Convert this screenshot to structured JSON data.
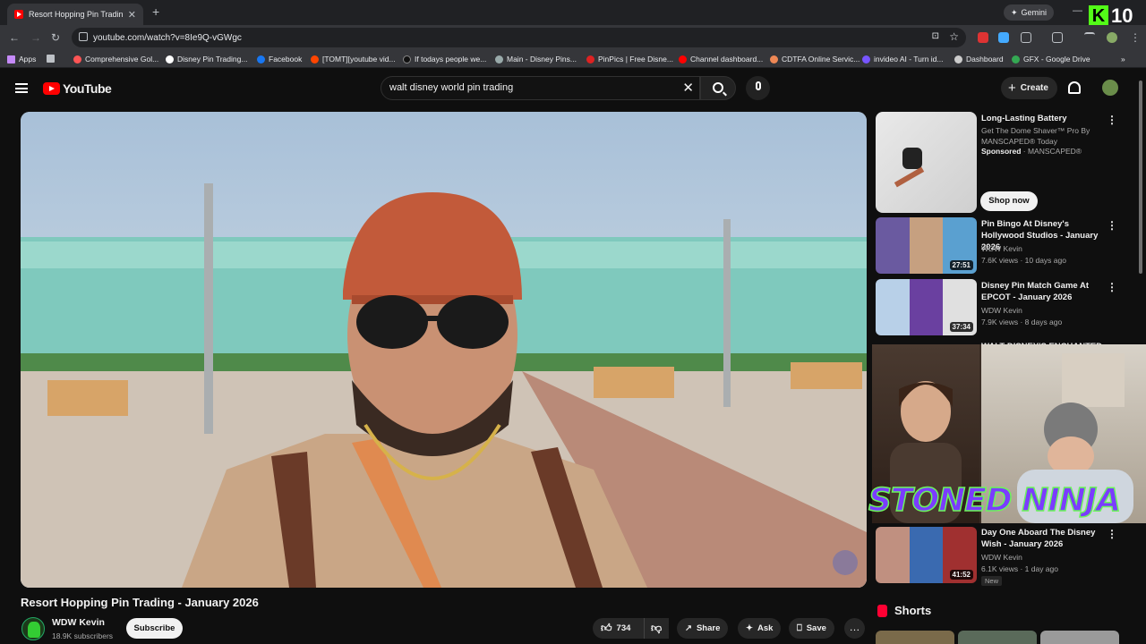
{
  "browser": {
    "tab_title": "Resort Hopping Pin Trading - Ja",
    "new_tab": "+",
    "gemini_label": "Gemini",
    "url": "youtube.com/watch?v=8Ie9Q-vGWgc",
    "bookmarks": [
      "Apps",
      "Comprehensive Gol...",
      "Disney Pin Trading...",
      "Facebook",
      "[TOMT][youtube vid...",
      "If todays people we...",
      "Main - Disney Pins...",
      "PinPics | Free Disne...",
      "Channel dashboard...",
      "CDTFA Online Servic...",
      "invideo AI - Turn id...",
      "Dashboard",
      "GFX - Google Drive"
    ]
  },
  "overlay": {
    "counter": "10",
    "k_badge": "K",
    "ninja_text": "STONED NINJA"
  },
  "youtube": {
    "logo_text": "YouTube",
    "search_value": "walt disney world pin trading",
    "clear_label": "✕",
    "create_label": "Create"
  },
  "video": {
    "title": "Resort Hopping Pin Trading - January 2026",
    "channel": "WDW Kevin",
    "subscribers": "18.9K subscribers",
    "subscribe_label": "Subscribe",
    "likes": "734",
    "share_label": "Share",
    "ask_label": "Ask",
    "save_label": "Save"
  },
  "sidebar": {
    "ad": {
      "title": "Long-Lasting Battery",
      "line1": "Get The Dome Shaver™ Pro By",
      "line2": "MANSCAPED® Today",
      "sponsored": "Sponsored",
      "advertiser": "MANSCAPED®",
      "cta": "Shop now"
    },
    "items": [
      {
        "title": "Pin Bingo At Disney's Hollywood Studios - January 2026",
        "channel": "WDW Kevin",
        "meta": "7.6K views · 10 days ago",
        "duration": "27:51"
      },
      {
        "title": "Disney Pin Match Game At EPCOT - January 2026",
        "channel": "WDW Kevin",
        "meta": "7.9K views · 8 days ago",
        "duration": "37:34"
      },
      {
        "title": "WALT DISNEY'S ENCHANTED"
      },
      {
        "title": "Day One Aboard The Disney Wish - January 2026",
        "channel": "WDW Kevin",
        "meta": "6.1K views · 1 day ago",
        "duration": "41:52",
        "badge": "New"
      }
    ],
    "shorts_label": "Shorts"
  }
}
